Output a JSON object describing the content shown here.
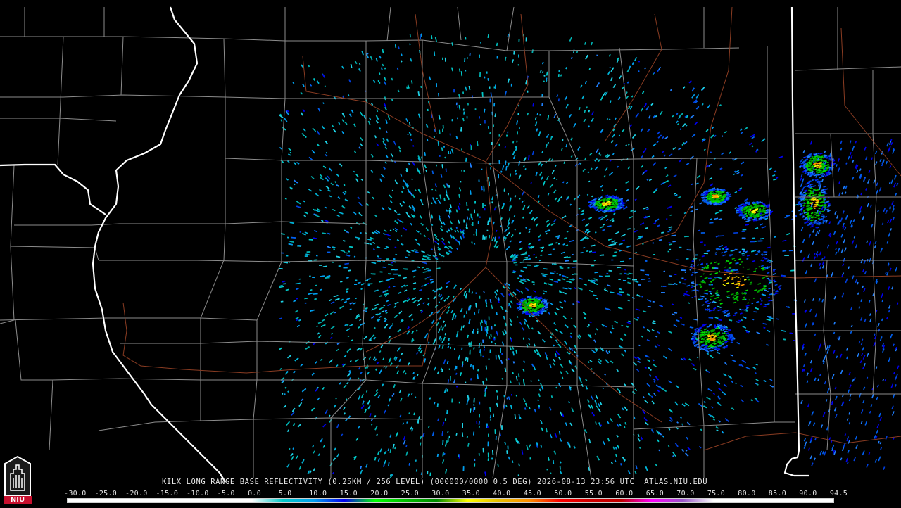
{
  "caption": "KILX LONG RANGE BASE REFLECTIVITY (0.25KM / 256 LEVEL) (000000/0000 0.5 DEG) 2026-08-13 23:56 UTC  ATLAS.NIU.EDU",
  "logo_text": "NIU",
  "colors": {
    "background": "#000000",
    "county_lines": "#8c8c8c",
    "state_lines": "#ffffff",
    "roads": "#8a3c22",
    "logo_red": "#c8102e"
  },
  "scale_labels": [
    "-30.0",
    "-25.0",
    "-20.0",
    "-15.0",
    "-10.0",
    "-5.0",
    "0.0",
    "5.0",
    "10.0",
    "15.0",
    "20.0",
    "25.0",
    "30.0",
    "35.0",
    "40.0",
    "45.0",
    "50.0",
    "55.0",
    "60.0",
    "65.0",
    "70.0",
    "75.0",
    "80.0",
    "85.0",
    "90.0",
    "94.5"
  ],
  "color_scale": [
    {
      "dbz": -30,
      "color": "#ffffff"
    },
    {
      "dbz": 0,
      "color": "#ffffff"
    },
    {
      "dbz": 5,
      "color": "#00c8c8"
    },
    {
      "dbz": 10,
      "color": "#00a0f0"
    },
    {
      "dbz": 15,
      "color": "#0000f0"
    },
    {
      "dbz": 20,
      "color": "#00ff00"
    },
    {
      "dbz": 25,
      "color": "#00c000"
    },
    {
      "dbz": 30,
      "color": "#008c00"
    },
    {
      "dbz": 35,
      "color": "#ffff00"
    },
    {
      "dbz": 40,
      "color": "#e8c000"
    },
    {
      "dbz": 45,
      "color": "#ff9000"
    },
    {
      "dbz": 50,
      "color": "#ff0000"
    },
    {
      "dbz": 55,
      "color": "#d00000"
    },
    {
      "dbz": 60,
      "color": "#c00000"
    },
    {
      "dbz": 65,
      "color": "#ff00ff"
    },
    {
      "dbz": 70,
      "color": "#9955c9"
    },
    {
      "dbz": 75,
      "color": "#ffffff"
    },
    {
      "dbz": 94.5,
      "color": "#ffffff"
    }
  ]
}
